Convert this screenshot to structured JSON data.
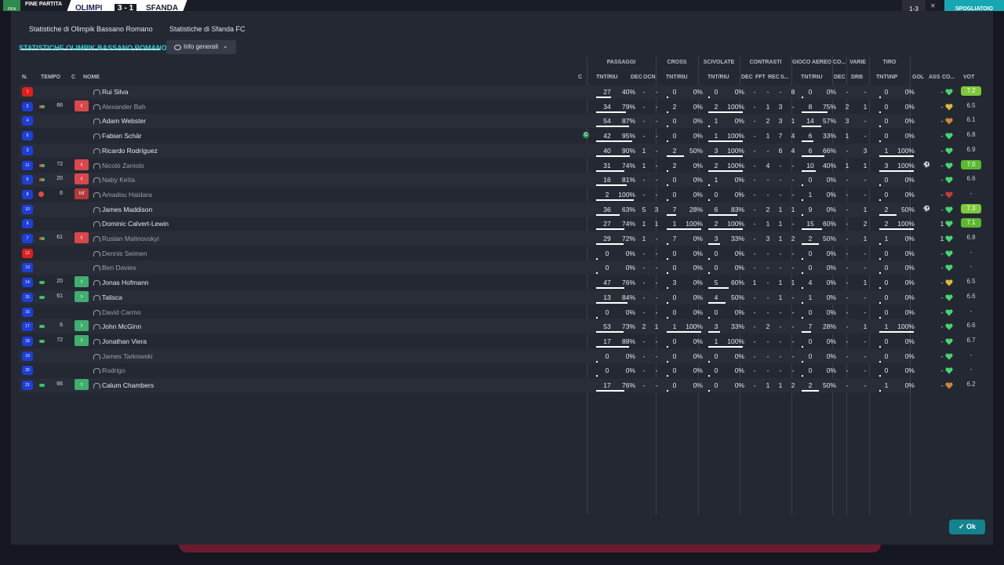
{
  "topbar": {
    "end_label": "FINE PARTITA",
    "team1": "OLIMPI",
    "score": "3 - 1",
    "team2": "SFANDA",
    "right_label": "1-3",
    "close": "✕",
    "button": "SPOGLIATOIO",
    "logo": "FIFA"
  },
  "tabs": [
    "Statistiche di Olimpik Bassano Romano",
    "Statistiche di Sfanda FC"
  ],
  "section_title": "STATISTICHE OLIMPIK BASSANO ROMANO",
  "dropdown": "Info generali",
  "groups": [
    "PASSAGGI",
    "CROSS",
    "SCIVOLATE",
    "CONTRASTI",
    "GIOCO AEREO",
    "CO...",
    "VARIE",
    "TIRO"
  ],
  "headers": {
    "n": "N.",
    "tempo": "TEMPO",
    "c": "C",
    "nome": "NOME",
    "c2": "C",
    "pass": "TNT/RIU",
    "dec": "DEC",
    "ocn": "OCN",
    "cross": "TNT/RIU",
    "scivolate": "TNT/RIU",
    "cdec": "DEC",
    "fft": "FFT",
    "rec": "REC",
    "s": "S...",
    "aereo": "TNT/RIU",
    "codec": "DEC",
    "drb": "DRB",
    "tiro": "TNT\\INP",
    "gol": "GOL",
    "ass": "ASS",
    "co": "CO...",
    "vot": "VOT"
  },
  "players": [
    {
      "n": "1",
      "name": "Rui Silva",
      "p": [
        "27",
        "40%"
      ],
      "dec": "-",
      "ocn": "-",
      "cr": [
        "0",
        "0%"
      ],
      "sc": [
        "0",
        "0%"
      ],
      "cdec": "-",
      "fft": "-",
      "rec": "-",
      "s": "8",
      "ae": [
        "0",
        "0%"
      ],
      "codec": "-",
      "drb": "-",
      "ti": [
        "0",
        "0%"
      ],
      "gol": "",
      "ass": "-",
      "vot": "7.2"
    },
    {
      "n": "2",
      "minute": "66",
      "cmark": "‹",
      "name": "Alexander Bah",
      "p": [
        "34",
        "79%"
      ],
      "dec": "-",
      "ocn": "-",
      "cr": [
        "2",
        "0%"
      ],
      "sc": [
        "2",
        "100%"
      ],
      "cdec": "-",
      "fft": "1",
      "rec": "3",
      "s": "-",
      "ae": [
        "8",
        "75%"
      ],
      "codec": "2",
      "drb": "1",
      "ti": [
        "0",
        "0%"
      ],
      "gol": "",
      "ass": "-",
      "vot": "6.5"
    },
    {
      "n": "4",
      "name": "Adam Webster",
      "p": [
        "54",
        "87%"
      ],
      "dec": "-",
      "ocn": "-",
      "cr": [
        "0",
        "0%"
      ],
      "sc": [
        "1",
        "0%"
      ],
      "cdec": "-",
      "fft": "2",
      "rec": "3",
      "s": "1",
      "ae": [
        "14",
        "57%"
      ],
      "codec": "3",
      "drb": "-",
      "ti": [
        "0",
        "0%"
      ],
      "gol": "",
      "ass": "-",
      "vot": "6.1"
    },
    {
      "n": "5",
      "name": "Fabian Schär",
      "cap": "C",
      "p": [
        "42",
        "95%"
      ],
      "dec": "-",
      "ocn": "-",
      "cr": [
        "0",
        "0%"
      ],
      "sc": [
        "1",
        "100%"
      ],
      "cdec": "-",
      "fft": "1",
      "rec": "7",
      "s": "4",
      "ae": [
        "6",
        "33%"
      ],
      "codec": "1",
      "drb": "-",
      "ti": [
        "0",
        "0%"
      ],
      "gol": "",
      "ass": "-",
      "vot": "6.8"
    },
    {
      "n": "3",
      "name": "Ricardo Rodríguez",
      "p": [
        "40",
        "90%"
      ],
      "dec": "1",
      "ocn": "-",
      "cr": [
        "2",
        "50%"
      ],
      "sc": [
        "3",
        "100%"
      ],
      "cdec": "-",
      "fft": "-",
      "rec": "6",
      "s": "4",
      "ae": [
        "6",
        "66%"
      ],
      "codec": "-",
      "drb": "3",
      "ti": [
        "1",
        "100%"
      ],
      "gol": "",
      "ass": "-",
      "vot": "6.9"
    },
    {
      "n": "11",
      "minute": "72",
      "cmark": "‹",
      "name": "Nicolò Zaniolo",
      "p": [
        "31",
        "74%"
      ],
      "dec": "1",
      "ocn": "-",
      "cr": [
        "2",
        "0%"
      ],
      "sc": [
        "2",
        "100%"
      ],
      "cdec": "-",
      "fft": "4",
      "rec": "-",
      "s": "-",
      "ae": [
        "10",
        "40%"
      ],
      "codec": "1",
      "drb": "1",
      "ti": [
        "3",
        "100%"
      ],
      "gol": "⚽",
      "ass": "-",
      "vot": "7.0"
    },
    {
      "n": "6",
      "minute": "20",
      "cmark": "‹",
      "name": "Naby Keïta",
      "p": [
        "16",
        "81%"
      ],
      "dec": "-",
      "ocn": "-",
      "cr": [
        "0",
        "0%"
      ],
      "sc": [
        "1",
        "0%"
      ],
      "cdec": "-",
      "fft": "-",
      "rec": "-",
      "s": "-",
      "ae": [
        "0",
        "0%"
      ],
      "codec": "-",
      "drb": "-",
      "ti": [
        "0",
        "0%"
      ],
      "gol": "",
      "ass": "-",
      "vot": "6.6"
    },
    {
      "n": "8",
      "minute": "6",
      "cmark": "Inf",
      "name": "Amadou Haidara",
      "p": [
        "2",
        "100%"
      ],
      "dec": "-",
      "ocn": "-",
      "cr": [
        "0",
        "0%"
      ],
      "sc": [
        "0",
        "0%"
      ],
      "cdec": "-",
      "fft": "-",
      "rec": "-",
      "s": "-",
      "ae": [
        "1",
        "0%"
      ],
      "codec": "-",
      "drb": "-",
      "ti": [
        "0",
        "0%"
      ],
      "gol": "",
      "ass": "-",
      "vot": "-"
    },
    {
      "n": "10",
      "name": "James Maddison",
      "p": [
        "36",
        "63%"
      ],
      "dec": "5",
      "ocn": "3",
      "cr": [
        "7",
        "28%"
      ],
      "sc": [
        "6",
        "83%"
      ],
      "cdec": "-",
      "fft": "2",
      "rec": "1",
      "s": "1",
      "ae": [
        "9",
        "0%"
      ],
      "codec": "-",
      "drb": "1",
      "ti": [
        "2",
        "50%"
      ],
      "gol": "⚽",
      "ass": "-",
      "vot": "7.3"
    },
    {
      "n": "9",
      "name": "Dominic Calvert-Lewin",
      "p": [
        "27",
        "74%"
      ],
      "dec": "1",
      "ocn": "1",
      "cr": [
        "1",
        "100%"
      ],
      "sc": [
        "2",
        "100%"
      ],
      "cdec": "-",
      "fft": "1",
      "rec": "1",
      "s": "-",
      "ae": [
        "15",
        "60%"
      ],
      "codec": "-",
      "drb": "2",
      "ti": [
        "2",
        "100%"
      ],
      "gol": "",
      "ass": "1",
      "vot": "7.1"
    },
    {
      "n": "7",
      "minute": "61",
      "cmark": "‹",
      "name": "Ruslan Malinovskyi",
      "p": [
        "29",
        "72%"
      ],
      "dec": "1",
      "ocn": "-",
      "cr": [
        "7",
        "0%"
      ],
      "sc": [
        "3",
        "33%"
      ],
      "cdec": "-",
      "fft": "3",
      "rec": "1",
      "s": "2",
      "ae": [
        "2",
        "50%"
      ],
      "codec": "-",
      "drb": "1",
      "ti": [
        "1",
        "0%"
      ],
      "gol": "",
      "ass": "1",
      "vot": "6.8"
    },
    {
      "n": "12",
      "name": "Dennis Seimen",
      "p": [
        "0",
        "0%"
      ],
      "dec": "-",
      "ocn": "-",
      "cr": [
        "0",
        "0%"
      ],
      "sc": [
        "0",
        "0%"
      ],
      "cdec": "-",
      "fft": "-",
      "rec": "-",
      "s": "-",
      "ae": [
        "0",
        "0%"
      ],
      "codec": "-",
      "drb": "-",
      "ti": [
        "0",
        "0%"
      ],
      "gol": "",
      "ass": "-",
      "vot": "-"
    },
    {
      "n": "13",
      "name": "Ben Davies",
      "p": [
        "0",
        "0%"
      ],
      "dec": "-",
      "ocn": "-",
      "cr": [
        "0",
        "0%"
      ],
      "sc": [
        "0",
        "0%"
      ],
      "cdec": "-",
      "fft": "-",
      "rec": "-",
      "s": "-",
      "ae": [
        "0",
        "0%"
      ],
      "codec": "-",
      "drb": "-",
      "ti": [
        "0",
        "0%"
      ],
      "gol": "",
      "ass": "-",
      "vot": "-"
    },
    {
      "n": "14",
      "minute": "20",
      "cmark": "›",
      "name": "Jonas Hofmann",
      "p": [
        "47",
        "76%"
      ],
      "dec": "-",
      "ocn": "-",
      "cr": [
        "3",
        "0%"
      ],
      "sc": [
        "5",
        "60%"
      ],
      "cdec": "1",
      "fft": "-",
      "rec": "1",
      "s": "1",
      "ae": [
        "4",
        "0%"
      ],
      "codec": "-",
      "drb": "1",
      "ti": [
        "0",
        "0%"
      ],
      "gol": "",
      "ass": "-",
      "vot": "6.5"
    },
    {
      "n": "15",
      "minute": "61",
      "cmark": "›",
      "name": "Talisca",
      "p": [
        "13",
        "84%"
      ],
      "dec": "-",
      "ocn": "-",
      "cr": [
        "0",
        "0%"
      ],
      "sc": [
        "4",
        "50%"
      ],
      "cdec": "-",
      "fft": "-",
      "rec": "1",
      "s": "-",
      "ae": [
        "1",
        "0%"
      ],
      "codec": "-",
      "drb": "-",
      "ti": [
        "0",
        "0%"
      ],
      "gol": "",
      "ass": "-",
      "vot": "6.6"
    },
    {
      "n": "16",
      "name": "David Carmo",
      "p": [
        "0",
        "0%"
      ],
      "dec": "-",
      "ocn": "-",
      "cr": [
        "0",
        "0%"
      ],
      "sc": [
        "0",
        "0%"
      ],
      "cdec": "-",
      "fft": "-",
      "rec": "-",
      "s": "-",
      "ae": [
        "0",
        "0%"
      ],
      "codec": "-",
      "drb": "-",
      "ti": [
        "0",
        "0%"
      ],
      "gol": "",
      "ass": "-",
      "vot": "-"
    },
    {
      "n": "17",
      "minute": "6",
      "cmark": "›",
      "name": "John McGinn",
      "p": [
        "53",
        "73%"
      ],
      "dec": "2",
      "ocn": "1",
      "cr": [
        "1",
        "100%"
      ],
      "sc": [
        "3",
        "33%"
      ],
      "cdec": "-",
      "fft": "2",
      "rec": "-",
      "s": "-",
      "ae": [
        "7",
        "28%"
      ],
      "codec": "-",
      "drb": "1",
      "ti": [
        "1",
        "100%"
      ],
      "gol": "",
      "ass": "-",
      "vot": "6.6"
    },
    {
      "n": "18",
      "minute": "72",
      "cmark": "›",
      "name": "Jonathan Viera",
      "p": [
        "17",
        "88%"
      ],
      "dec": "-",
      "ocn": "-",
      "cr": [
        "0",
        "0%"
      ],
      "sc": [
        "1",
        "100%"
      ],
      "cdec": "-",
      "fft": "-",
      "rec": "-",
      "s": "-",
      "ae": [
        "0",
        "0%"
      ],
      "codec": "-",
      "drb": "-",
      "ti": [
        "0",
        "0%"
      ],
      "gol": "",
      "ass": "-",
      "vot": "6.7"
    },
    {
      "n": "19",
      "name": "James Tarkowski",
      "p": [
        "0",
        "0%"
      ],
      "dec": "-",
      "ocn": "-",
      "cr": [
        "0",
        "0%"
      ],
      "sc": [
        "0",
        "0%"
      ],
      "cdec": "-",
      "fft": "-",
      "rec": "-",
      "s": "-",
      "ae": [
        "0",
        "0%"
      ],
      "codec": "-",
      "drb": "-",
      "ti": [
        "0",
        "0%"
      ],
      "gol": "",
      "ass": "-",
      "vot": "-"
    },
    {
      "n": "20",
      "name": "Rodrigo",
      "p": [
        "0",
        "0%"
      ],
      "dec": "-",
      "ocn": "-",
      "cr": [
        "0",
        "0%"
      ],
      "sc": [
        "0",
        "0%"
      ],
      "cdec": "-",
      "fft": "-",
      "rec": "-",
      "s": "-",
      "ae": [
        "0",
        "0%"
      ],
      "codec": "-",
      "drb": "-",
      "ti": [
        "0",
        "0%"
      ],
      "gol": "",
      "ass": "-",
      "vot": "-"
    },
    {
      "n": "21",
      "minute": "66",
      "cmark": "›",
      "name": "Calum Chambers",
      "p": [
        "17",
        "76%"
      ],
      "dec": "-",
      "ocn": "-",
      "cr": [
        "0",
        "0%"
      ],
      "sc": [
        "0",
        "0%"
      ],
      "cdec": "-",
      "fft": "1",
      "rec": "1",
      "s": "2",
      "ae": [
        "2",
        "50%"
      ],
      "codec": "-",
      "drb": "-",
      "ti": [
        "1",
        "0%"
      ],
      "gol": "",
      "ass": "-",
      "vot": "6.2"
    }
  ],
  "ok_label": "Ok",
  "colors": {
    "accent": "#2fd0d8",
    "vote_green": "#5cb82e",
    "vote_bright": "#7ec93a",
    "out": "#d9474b",
    "in": "#3fae6f",
    "gk": "#e01e1e",
    "field": "#1d3fd8"
  }
}
